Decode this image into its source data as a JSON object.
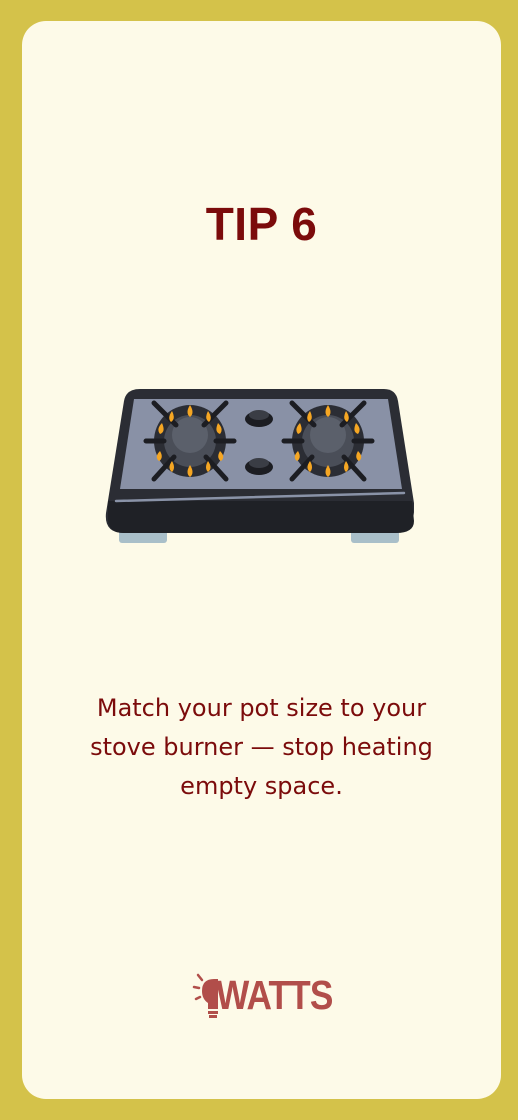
{
  "card": {
    "title": "TIP 6",
    "body": "Match your pot size to your stove burner — stop heating empty space."
  },
  "illustration": {
    "icon": "gas-stove-icon",
    "burners_lit": 2
  },
  "brand": {
    "logo_text": "WATTS",
    "logo_icon": "lightbulb-icon"
  },
  "colors": {
    "frame": "#d4c24a",
    "card_background": "#fdfae8",
    "title": "#7b0b0b",
    "body_text": "#7b0b0b",
    "logo": "#b14e4a",
    "flame": "#f5a623"
  }
}
